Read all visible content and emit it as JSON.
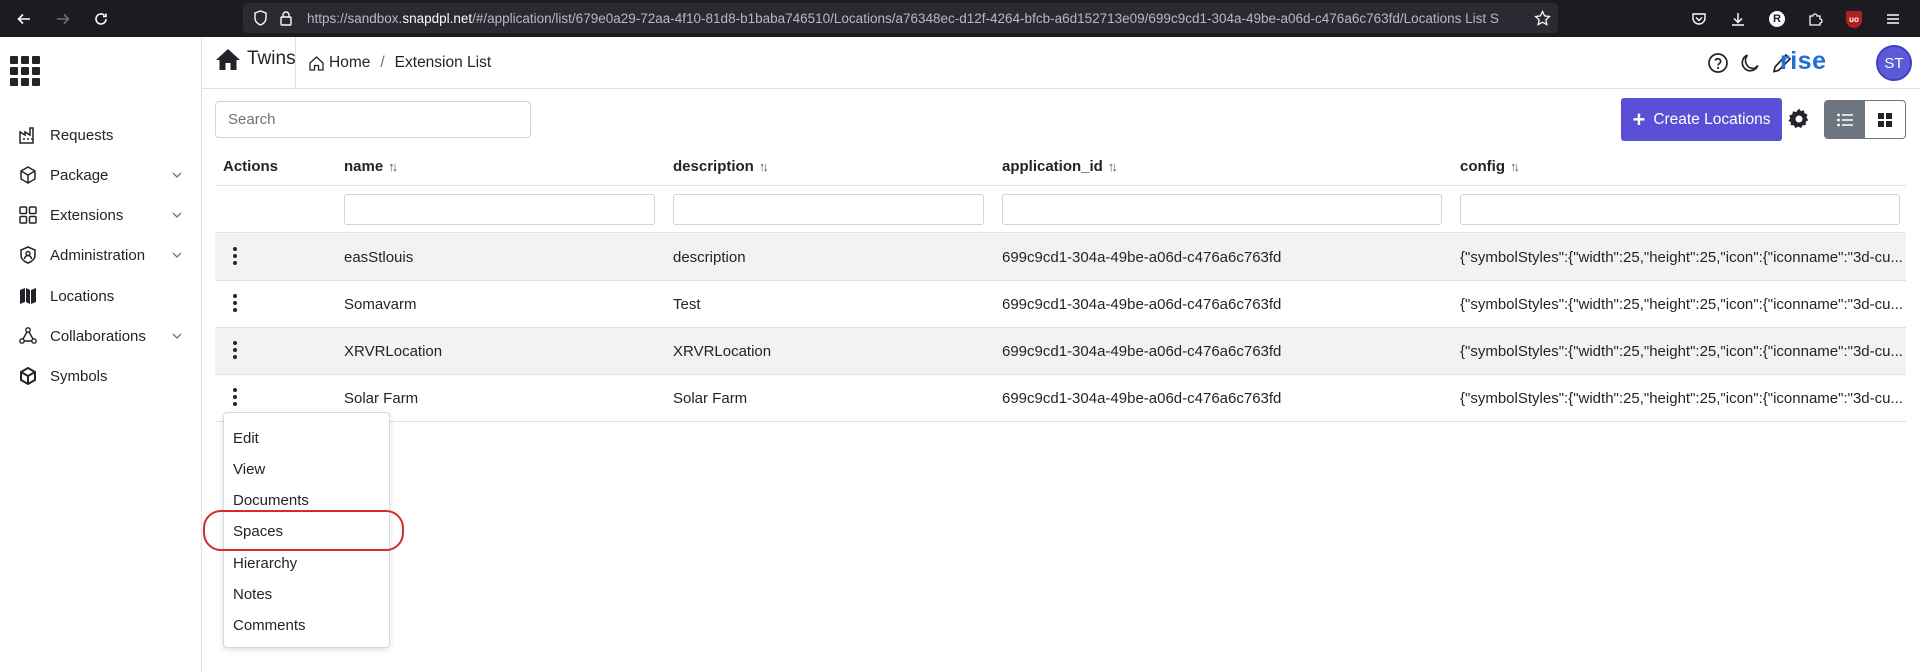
{
  "browser": {
    "url_prefix": "https://sandbox.",
    "url_domain": "snapdpl.net",
    "url_rest": "/#/application/list/679e0a29-72aa-4f10-81d8-b1baba746510/Locations/a76348ec-d12f-4264-bfcb-a6d152713e09/699c9cd1-304a-49be-a06d-c476a6c763fd/Locations List S",
    "profile_badge": "R",
    "ublock_label": "uo"
  },
  "sidebar": {
    "items": [
      {
        "label": "Requests",
        "icon": "factory-icon",
        "has_children": false
      },
      {
        "label": "Package",
        "icon": "package-icon",
        "has_children": true
      },
      {
        "label": "Extensions",
        "icon": "extensions-icon",
        "has_children": true
      },
      {
        "label": "Administration",
        "icon": "shield-user-icon",
        "has_children": true
      },
      {
        "label": "Locations",
        "icon": "map-icon",
        "has_children": false
      },
      {
        "label": "Collaborations",
        "icon": "network-icon",
        "has_children": true
      },
      {
        "label": "Symbols",
        "icon": "cube-icon",
        "has_children": false
      }
    ]
  },
  "header": {
    "app_name": "Twins",
    "breadcrumb": [
      {
        "label": "Home"
      },
      {
        "label": "Extension List"
      }
    ],
    "logo_text": "rise",
    "avatar_initials": "ST"
  },
  "toolbar": {
    "search_placeholder": "Search",
    "create_label": "Create Locations"
  },
  "table": {
    "columns": [
      {
        "label": "Actions",
        "sortable": false
      },
      {
        "label": "name",
        "sortable": true
      },
      {
        "label": "description",
        "sortable": true
      },
      {
        "label": "application_id",
        "sortable": true
      },
      {
        "label": "config",
        "sortable": true
      }
    ],
    "rows": [
      {
        "name": "easStlouis",
        "description": "description",
        "application_id": "699c9cd1-304a-49be-a06d-c476a6c763fd",
        "config": "{\"symbolStyles\":{\"width\":25,\"height\":25,\"icon\":{\"iconname\":\"3d-cu..."
      },
      {
        "name": "Somavarm",
        "description": "Test",
        "application_id": "699c9cd1-304a-49be-a06d-c476a6c763fd",
        "config": "{\"symbolStyles\":{\"width\":25,\"height\":25,\"icon\":{\"iconname\":\"3d-cu..."
      },
      {
        "name": "XRVRLocation",
        "description": "XRVRLocation",
        "application_id": "699c9cd1-304a-49be-a06d-c476a6c763fd",
        "config": "{\"symbolStyles\":{\"width\":25,\"height\":25,\"icon\":{\"iconname\":\"3d-cu..."
      },
      {
        "name": "Solar Farm",
        "description": "Solar Farm",
        "application_id": "699c9cd1-304a-49be-a06d-c476a6c763fd",
        "config": "{\"symbolStyles\":{\"width\":25,\"height\":25,\"icon\":{\"iconname\":\"3d-cu..."
      }
    ]
  },
  "action_menu": {
    "items": [
      "Edit",
      "View",
      "Documents",
      "Spaces",
      "Hierarchy",
      "Notes",
      "Comments"
    ],
    "highlighted": "Spaces"
  },
  "colors": {
    "primary": "#5a4fd6",
    "logo": "#1e6fd9",
    "highlight_ring": "#d22b2b"
  }
}
